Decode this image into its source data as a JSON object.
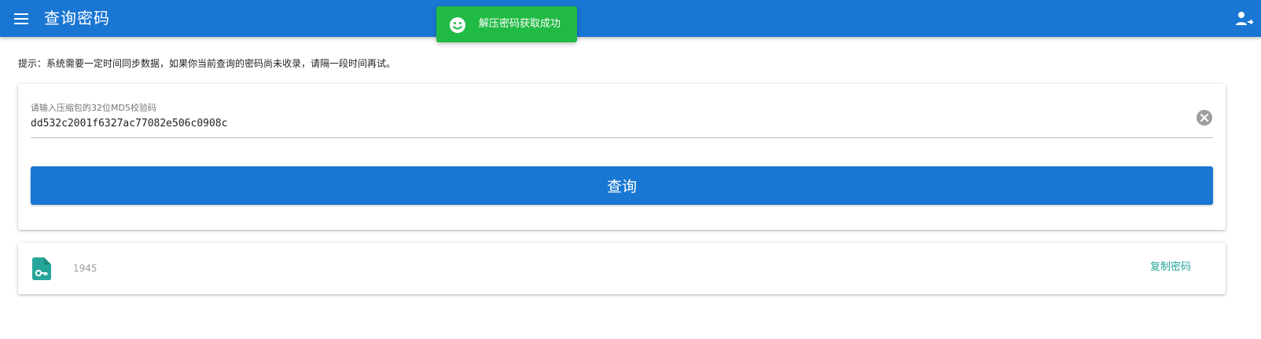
{
  "header": {
    "title": "查询密码",
    "menu_icon": "menu-icon",
    "user_icon": "account-arrow-icon",
    "background_color": "#1976d2"
  },
  "toast": {
    "message": "解压密码获取成功",
    "icon": "smile-icon",
    "background_color": "#21ba45"
  },
  "hint": {
    "text": "提示：系统需要一定时间同步数据，如果你当前查询的密码尚未收录，请隔一段时间再试。"
  },
  "query_form": {
    "field_label": "请输入压缩包的32位MD5校验码",
    "field_value": "dd532c2001f6327ac77082e506c0908c",
    "clear_icon": "clear-circle-icon",
    "submit_label": "查询"
  },
  "result": {
    "file_icon": "file-key-icon",
    "password": "1945",
    "copy_label": "复制密码",
    "accent_color": "#26a69a"
  }
}
